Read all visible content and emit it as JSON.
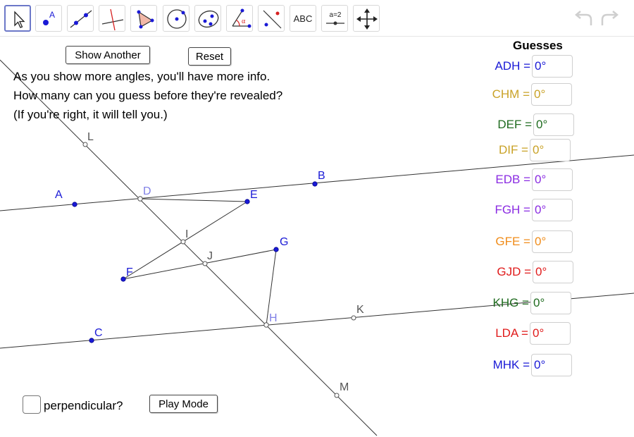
{
  "toolbar": {
    "tools": [
      {
        "name": "move-tool"
      },
      {
        "name": "point-tool",
        "glyph": "A"
      },
      {
        "name": "line-tool"
      },
      {
        "name": "perpendicular-line-tool"
      },
      {
        "name": "polygon-tool"
      },
      {
        "name": "circle-tool"
      },
      {
        "name": "conic-tool"
      },
      {
        "name": "angle-tool",
        "glyph": "α"
      },
      {
        "name": "reflect-tool"
      },
      {
        "name": "text-tool",
        "label": "ABC"
      },
      {
        "name": "slider-tool",
        "label": "a=2"
      },
      {
        "name": "move-graphics-view-tool"
      }
    ]
  },
  "buttons": {
    "show_another": "Show Another",
    "reset": "Reset",
    "play_mode": "Play Mode"
  },
  "instructions": [
    "As you show more angles, you'll have more info.",
    "How many can you guess before they're revealed?",
    "(If you're right, it will tell you.)"
  ],
  "guesses": {
    "title": "Guesses",
    "items": [
      {
        "label": "ADH =",
        "value": "0°",
        "color": "#1a1ad6"
      },
      {
        "label": "CHM =",
        "value": "0°",
        "color": "#c9a227"
      },
      {
        "label": "DEF =",
        "value": "0°",
        "color": "#1f6b1f"
      },
      {
        "label": "DIF =",
        "value": "0°",
        "color": "#c9a227"
      },
      {
        "label": "EDB =",
        "value": "0°",
        "color": "#8a2be2"
      },
      {
        "label": "FGH =",
        "value": "0°",
        "color": "#8a2be2"
      },
      {
        "label": "GFE =",
        "value": "0°",
        "color": "#f08c1a"
      },
      {
        "label": "GJD =",
        "value": "0°",
        "color": "#e01b1b"
      },
      {
        "label": "KHG =",
        "value": "0°",
        "color": "#1f6b1f"
      },
      {
        "label": "LDA =",
        "value": "0°",
        "color": "#e01b1b"
      },
      {
        "label": "MHK =",
        "value": "0°",
        "color": "#1a1ad6"
      }
    ]
  },
  "perpendicular": {
    "label": "perpendicular?",
    "checked": false
  },
  "points": {
    "A": "A",
    "B": "B",
    "C": "C",
    "D": "D",
    "E": "E",
    "F": "F",
    "G": "G",
    "H": "H",
    "I": "I",
    "J": "J",
    "K": "K",
    "L": "L",
    "M": "M"
  },
  "colors": {
    "point_blue": "#1a1ad6",
    "point_gray": "#555555",
    "label_blue": "#1a1ad6",
    "label_light": "#8080e6"
  }
}
